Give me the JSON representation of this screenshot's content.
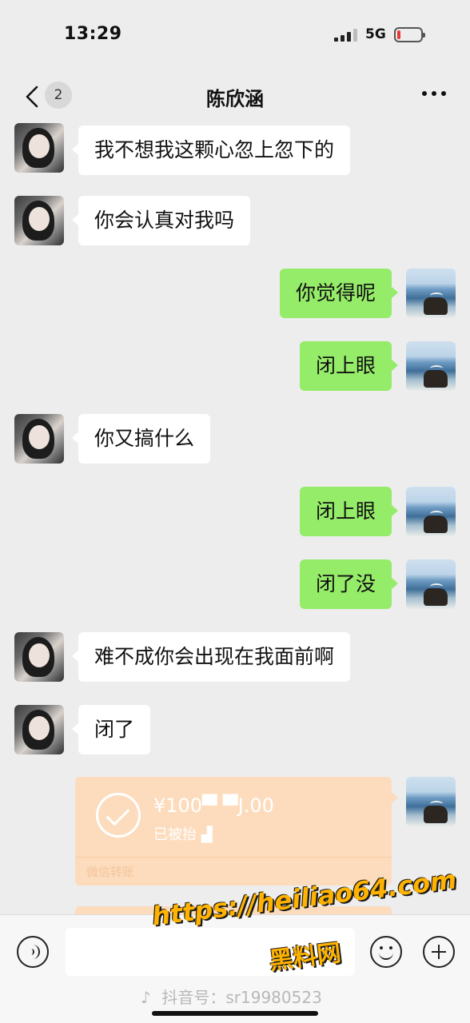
{
  "status_bar": {
    "time": "13:29",
    "network": "5G"
  },
  "nav": {
    "title": "陈欣涵",
    "unread_count": "2"
  },
  "messages": [
    {
      "side": "left",
      "text": "我不想我这颗心忽上忽下的"
    },
    {
      "side": "left",
      "text": "你会认真对我吗"
    },
    {
      "side": "right",
      "text": "你觉得呢"
    },
    {
      "side": "right",
      "text": "闭上眼"
    },
    {
      "side": "left",
      "text": "你又搞什么"
    },
    {
      "side": "right",
      "text": "闭上眼"
    },
    {
      "side": "right",
      "text": "闭了没"
    },
    {
      "side": "left",
      "text": "难不成你会出现在我面前啊"
    },
    {
      "side": "left",
      "text": "闭了"
    }
  ],
  "transfer": {
    "amount": "¥100▀ ▀J.00",
    "status": "已被抬 ▟",
    "footer": "微信转账"
  },
  "input_bar": {
    "placeholder": ""
  },
  "watermark": {
    "url": "https://heiliao64.com",
    "brand": "黑料网",
    "douyin": "抖音号：sr19980523"
  },
  "colors": {
    "bubble_right": "#95ec69",
    "bubble_left": "#ffffff",
    "background": "#ededed",
    "transfer_card": "#fcdcbd"
  }
}
